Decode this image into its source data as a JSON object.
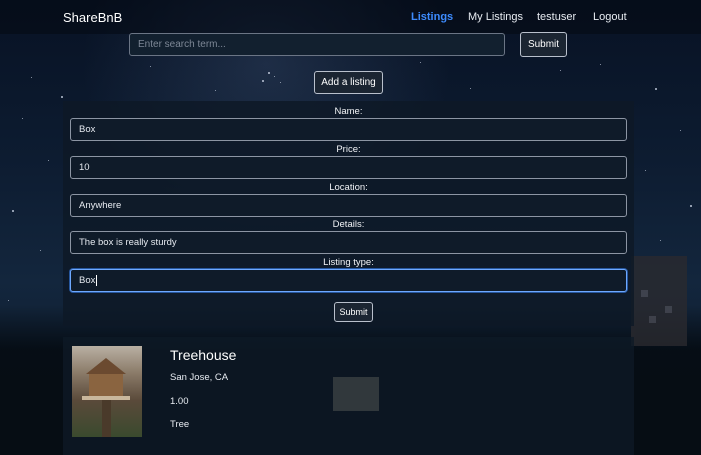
{
  "navbar": {
    "brand": "ShareBnB",
    "links": [
      {
        "label": "Listings",
        "active": true
      },
      {
        "label": "My Listings",
        "active": false
      },
      {
        "label": "testuser",
        "active": false
      },
      {
        "label": "Logout",
        "active": false
      }
    ]
  },
  "search": {
    "placeholder": "Enter search term...",
    "value": "",
    "submit_label": "Submit"
  },
  "add_listing_label": "Add a listing",
  "form": {
    "fields": [
      {
        "label": "Name:",
        "value": "Box"
      },
      {
        "label": "Price:",
        "value": "10"
      },
      {
        "label": "Location:",
        "value": "Anywhere"
      },
      {
        "label": "Details:",
        "value": "The box is really sturdy"
      },
      {
        "label": "Listing type:",
        "value": "Box",
        "focused": true
      }
    ],
    "submit_label": "Submit"
  },
  "listings": [
    {
      "title": "Treehouse",
      "location": "San Jose, CA",
      "price": "1.00",
      "type": "Tree",
      "image_icon": "treehouse-photo"
    }
  ],
  "colors": {
    "active_link": "#3d8bfd",
    "focus_border": "#6ea8fe",
    "background": "#0d1c31"
  }
}
